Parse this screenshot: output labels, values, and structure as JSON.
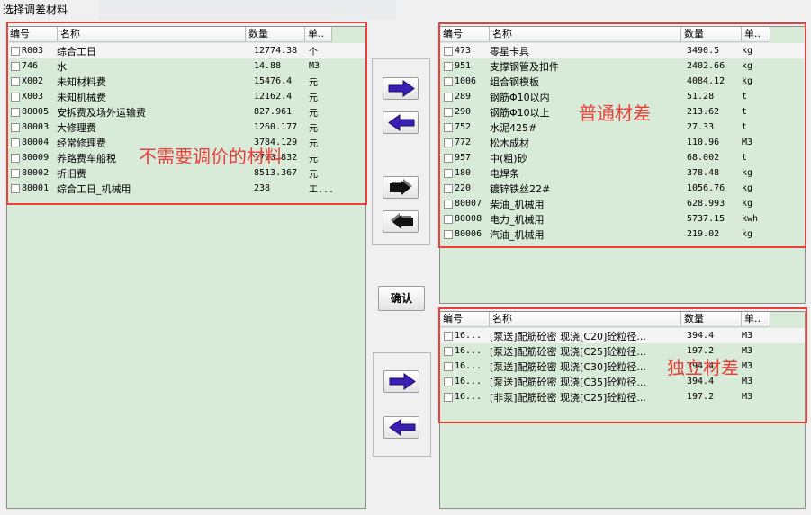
{
  "window": {
    "title": "选择调差材料"
  },
  "columns": {
    "code": "编号",
    "name": "名称",
    "qty": "数量",
    "unit": "单.."
  },
  "left_list": {
    "rows": [
      {
        "code": "R003",
        "name": "综合工日",
        "qty": "12774.38",
        "unit": "个"
      },
      {
        "code": "746",
        "name": "水",
        "qty": "14.88",
        "unit": "M3"
      },
      {
        "code": "X002",
        "name": "未知材料费",
        "qty": "15476.4",
        "unit": "元"
      },
      {
        "code": "X003",
        "name": "未知机械费",
        "qty": "12162.4",
        "unit": "元"
      },
      {
        "code": "80005",
        "name": "安拆费及场外运输费",
        "qty": "827.961",
        "unit": "元"
      },
      {
        "code": "80003",
        "name": "大修理费",
        "qty": "1260.177",
        "unit": "元"
      },
      {
        "code": "80004",
        "name": "经常修理费",
        "qty": "3784.129",
        "unit": "元"
      },
      {
        "code": "80009",
        "name": "养路费车船税",
        "qty": "1793.832",
        "unit": "元"
      },
      {
        "code": "80002",
        "name": "折旧费",
        "qty": "8513.367",
        "unit": "元"
      },
      {
        "code": "80001",
        "name": "综合工日_机械用",
        "qty": "238",
        "unit": "工..."
      }
    ]
  },
  "right_top_list": {
    "rows": [
      {
        "code": "473",
        "name": "零星卡具",
        "qty": "3490.5",
        "unit": "kg"
      },
      {
        "code": "951",
        "name": "支撑钢管及扣件",
        "qty": "2402.66",
        "unit": "kg"
      },
      {
        "code": "1006",
        "name": "组合钢模板",
        "qty": "4084.12",
        "unit": "kg"
      },
      {
        "code": "289",
        "name": "钢筋Φ10以内",
        "qty": "51.28",
        "unit": "t"
      },
      {
        "code": "290",
        "name": "钢筋Φ10以上",
        "qty": "213.62",
        "unit": "t"
      },
      {
        "code": "752",
        "name": "水泥425#",
        "qty": "27.33",
        "unit": "t"
      },
      {
        "code": "772",
        "name": "松木成材",
        "qty": "110.96",
        "unit": "M3"
      },
      {
        "code": "957",
        "name": "中(粗)砂",
        "qty": "68.002",
        "unit": "t"
      },
      {
        "code": "180",
        "name": "电焊条",
        "qty": "378.48",
        "unit": "kg"
      },
      {
        "code": "220",
        "name": "镀锌铁丝22#",
        "qty": "1056.76",
        "unit": "kg"
      },
      {
        "code": "80007",
        "name": "柴油_机械用",
        "qty": "628.993",
        "unit": "kg"
      },
      {
        "code": "80008",
        "name": "电力_机械用",
        "qty": "5737.15",
        "unit": "kwh"
      },
      {
        "code": "80006",
        "name": "汽油_机械用",
        "qty": "219.02",
        "unit": "kg"
      }
    ]
  },
  "right_bottom_list": {
    "rows": [
      {
        "code": "16...",
        "name": "[泵送]配筋砼密 现浇[C20]砼粒径...",
        "qty": "394.4",
        "unit": "M3"
      },
      {
        "code": "16...",
        "name": "[泵送]配筋砼密 现浇[C25]砼粒径...",
        "qty": "197.2",
        "unit": "M3"
      },
      {
        "code": "16...",
        "name": "[泵送]配筋砼密 现浇[C30]砼粒径...",
        "qty": "394.4",
        "unit": "M3"
      },
      {
        "code": "16...",
        "name": "[泵送]配筋砼密 现浇[C35]砼粒径...",
        "qty": "394.4",
        "unit": "M3"
      },
      {
        "code": "16...",
        "name": "[非泵]配筋砼密 现浇[C25]砼粒径...",
        "qty": "197.2",
        "unit": "M3"
      }
    ]
  },
  "buttons": {
    "confirm": "确认"
  },
  "annotations": {
    "left": "不需要调价的材料",
    "top_right": "普通材差",
    "bottom_right": "独立材差"
  },
  "colors": {
    "panel_bg": "#d8ebd8",
    "annotation_red": "#e8403c",
    "arrow_fill": "#3b1fb5"
  }
}
